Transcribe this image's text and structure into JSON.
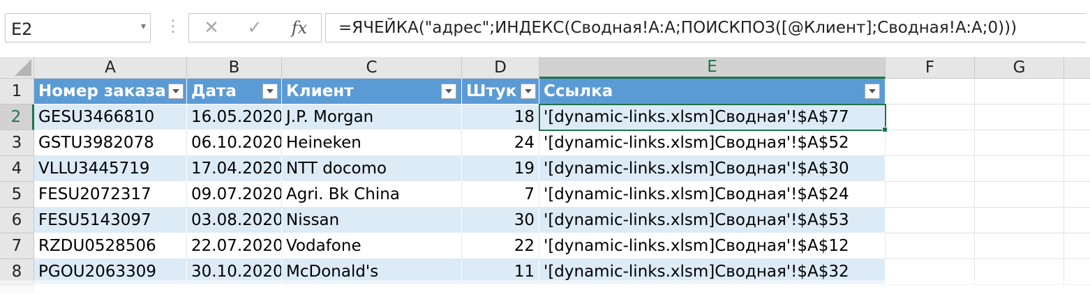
{
  "formula_bar": {
    "name_box": "E2",
    "name_box_arrow": "▾",
    "grip": "⋮",
    "cancel_glyph": "✕",
    "enter_glyph": "✓",
    "fx_glyph": "fx",
    "formula": "=ЯЧЕЙКА(\"адрес\";ИНДЕКС(Сводная!A:A;ПОИСКПОЗ([@Клиент];Сводная!A:A;0)))"
  },
  "grid": {
    "active_cell": "E2",
    "columns": [
      "A",
      "B",
      "C",
      "D",
      "E",
      "F",
      "G"
    ],
    "row_numbers": [
      "1",
      "2",
      "3",
      "4",
      "5",
      "6",
      "7",
      "8"
    ],
    "table": {
      "headers": [
        "Номер заказа",
        "Дата",
        "Клиент",
        "Штук",
        "Ссылка"
      ],
      "rows": [
        [
          "GESU3466810",
          "16.05.2020",
          "J.P. Morgan",
          "18",
          "'[dynamic-links.xlsm]Сводная'!$A$77"
        ],
        [
          "GSTU3982078",
          "06.10.2020",
          "Heineken",
          "24",
          "'[dynamic-links.xlsm]Сводная'!$A$52"
        ],
        [
          "VLLU3445719",
          "17.04.2020",
          "NTT docomo",
          "19",
          "'[dynamic-links.xlsm]Сводная'!$A$30"
        ],
        [
          "FESU2072317",
          "09.07.2020",
          "Agri. Bk China",
          "7",
          "'[dynamic-links.xlsm]Сводная'!$A$24"
        ],
        [
          "FESU5143097",
          "03.08.2020",
          "Nissan",
          "30",
          "'[dynamic-links.xlsm]Сводная'!$A$53"
        ],
        [
          "RZDU0528506",
          "22.07.2020",
          "Vodafone",
          "22",
          "'[dynamic-links.xlsm]Сводная'!$A$12"
        ],
        [
          "PGOU2063309",
          "30.10.2020",
          "McDonald's",
          "11",
          "'[dynamic-links.xlsm]Сводная'!$A$32"
        ]
      ]
    }
  },
  "colors": {
    "table_header": "#5b9bd5",
    "band": "#ddebf7",
    "selection": "#217346"
  }
}
